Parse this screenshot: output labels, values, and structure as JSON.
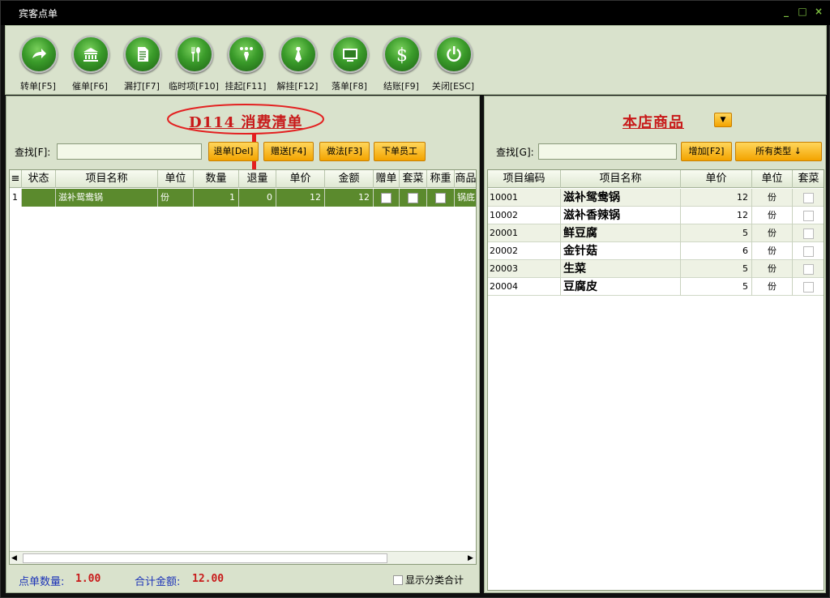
{
  "window": {
    "title": "宾客点单"
  },
  "toolbar": [
    {
      "label": "转单[F5]",
      "icon": "transfer-arrow-icon"
    },
    {
      "label": "催单[F6]",
      "icon": "bank-building-icon"
    },
    {
      "label": "漏打[F7]",
      "icon": "document-icon"
    },
    {
      "label": "临时项[F10]",
      "icon": "fork-spoon-icon"
    },
    {
      "label": "挂起[F11]",
      "icon": "hanger-icon"
    },
    {
      "label": "解挂[F12]",
      "icon": "tie-icon"
    },
    {
      "label": "落单[F8]",
      "icon": "screen-icon"
    },
    {
      "label": "结账[F9]",
      "icon": "dollar-icon"
    },
    {
      "label": "关闭[ESC]",
      "icon": "power-icon"
    }
  ],
  "order": {
    "title": "D114  消费清单",
    "search_label": "查找[F]:",
    "search_value": "",
    "buttons": [
      "退单[Del]",
      "赠送[F4]",
      "做法[F3]",
      "下单员工"
    ],
    "columns": [
      "≡",
      "状态",
      "项目名称",
      "单位",
      "数量",
      "退量",
      "单价",
      "金额",
      "赠单",
      "套菜",
      "称重",
      "商品"
    ],
    "rows": [
      {
        "no": "1",
        "status": "",
        "name": "滋补鸳鸯锅",
        "unit": "份",
        "qty": "1",
        "ret": "0",
        "price": "12",
        "amount": "12",
        "gift": false,
        "set": false,
        "weigh": false,
        "extra": "锅底"
      }
    ],
    "summary": {
      "count_label": "点单数量:",
      "count_value": "1.00",
      "total_label": "合计金额:",
      "total_value": "12.00",
      "checkbox_label": "显示分类合计"
    }
  },
  "catalog": {
    "title": "本店商品",
    "search_label": "查找[G]:",
    "search_value": "",
    "add_button": "增加[F2]",
    "type_button": "所有类型 ↓",
    "columns": [
      "项目编码",
      "项目名称",
      "单价",
      "单位",
      "套菜"
    ],
    "rows": [
      {
        "code": "10001",
        "name": "滋补鸳鸯锅",
        "price": "12",
        "unit": "份"
      },
      {
        "code": "10002",
        "name": "滋补香辣锅",
        "price": "12",
        "unit": "份"
      },
      {
        "code": "20001",
        "name": "鲜豆腐",
        "price": "5",
        "unit": "份"
      },
      {
        "code": "20002",
        "name": "金针菇",
        "price": "6",
        "unit": "份"
      },
      {
        "code": "20003",
        "name": "生菜",
        "price": "5",
        "unit": "份"
      },
      {
        "code": "20004",
        "name": "豆腐皮",
        "price": "5",
        "unit": "份"
      }
    ]
  }
}
